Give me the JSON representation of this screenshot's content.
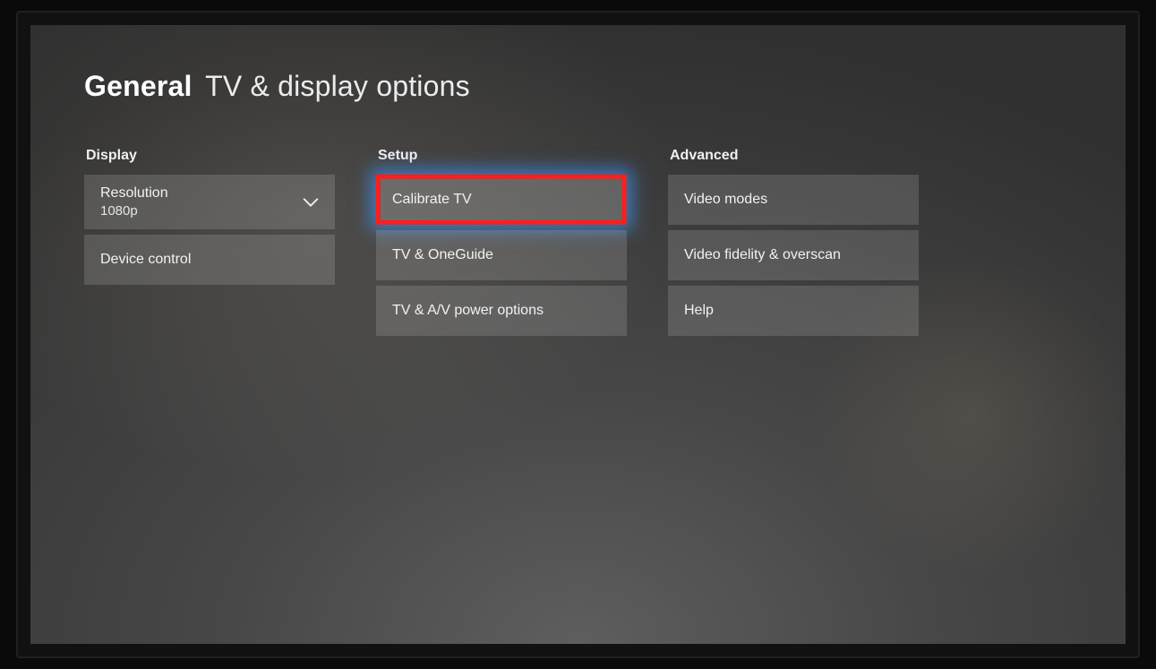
{
  "header": {
    "title_bold": "General",
    "title_rest": "TV & display options"
  },
  "columns": {
    "display": {
      "label": "Display",
      "resolution": {
        "label": "Resolution",
        "value": "1080p"
      },
      "device_control": "Device control"
    },
    "setup": {
      "label": "Setup",
      "calibrate_tv": "Calibrate TV",
      "tv_oneguide": "TV & OneGuide",
      "tv_av_power": "TV & A/V power options"
    },
    "advanced": {
      "label": "Advanced",
      "video_modes": "Video modes",
      "video_fidelity_overscan": "Video fidelity & overscan",
      "help": "Help"
    }
  }
}
